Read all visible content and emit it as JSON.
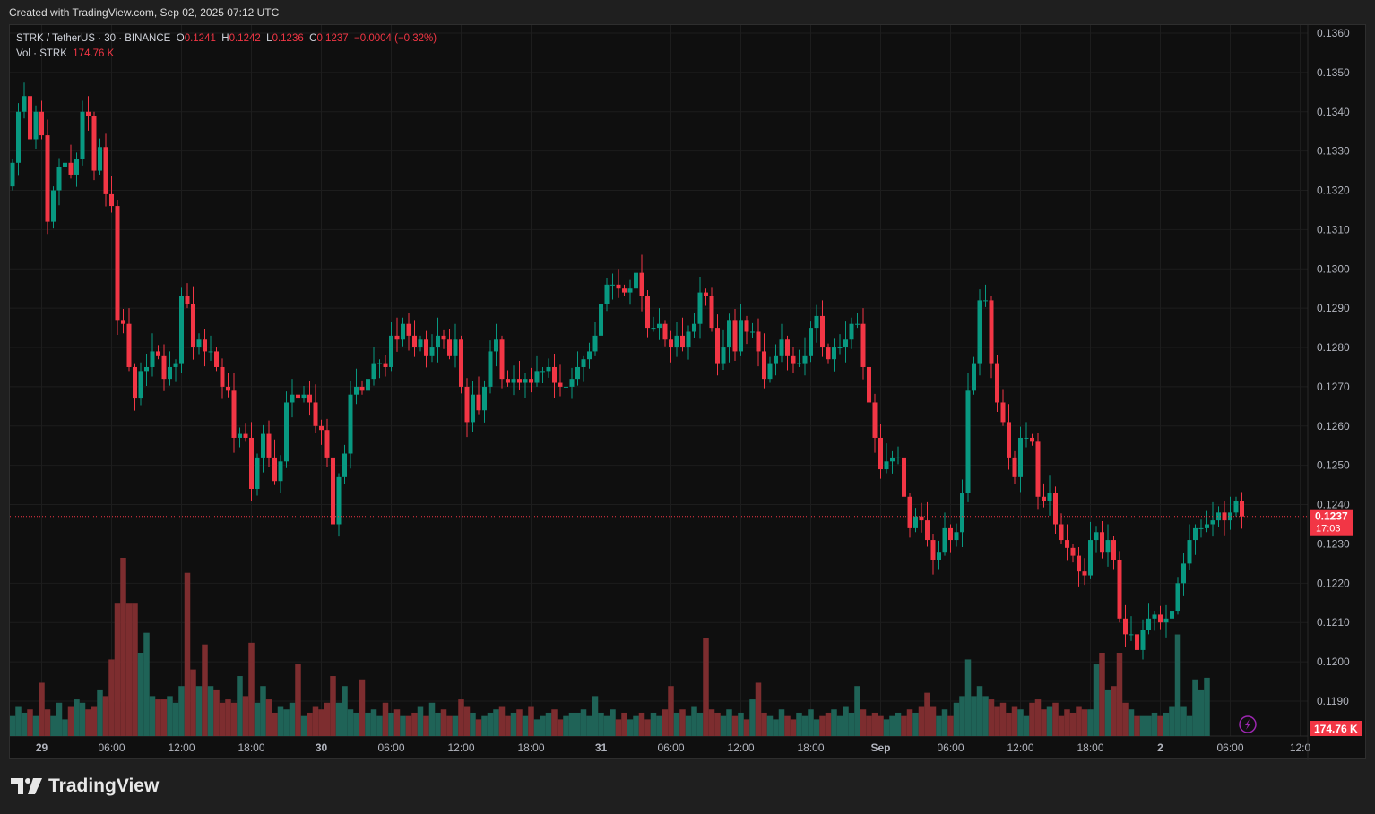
{
  "header": {
    "created": "Created with TradingView.com, Sep 02, 2025 07:12 UTC"
  },
  "legend": {
    "symbol": "STRK / TetherUS · 30 · BINANCE",
    "o_label": "O",
    "o": "0.1241",
    "h_label": "H",
    "h": "0.1242",
    "l_label": "L",
    "l": "0.1236",
    "c_label": "C",
    "c": "0.1237",
    "change": "−0.0004 (−0.32%)",
    "vol_label": "Vol · STRK",
    "vol": "174.76 K"
  },
  "price_tag": {
    "price": "0.1237",
    "countdown": "17:03"
  },
  "vol_tag": "174.76 K",
  "footer": {
    "logo": "TradingView"
  },
  "colors": {
    "up": "#089981",
    "down": "#f23645",
    "vol_up": "#1f6357",
    "vol_down": "#7d2d2f",
    "bg": "#0f0f0f",
    "grid": "#1d1d1d"
  },
  "chart_data": {
    "type": "candlestick",
    "title": "STRK / TetherUS · 30 · BINANCE",
    "ylim": [
      0.1185,
      0.1362
    ],
    "y_ticks": [
      "0.1360",
      "0.1350",
      "0.1340",
      "0.1330",
      "0.1320",
      "0.1310",
      "0.1300",
      "0.1290",
      "0.1280",
      "0.1270",
      "0.1260",
      "0.1250",
      "0.1240",
      "0.1230",
      "0.1220",
      "0.1210",
      "0.1200",
      "0.1190"
    ],
    "x_ticks": [
      "29",
      "06:00",
      "12:00",
      "18:00",
      "30",
      "06:00",
      "12:00",
      "18:00",
      "31",
      "06:00",
      "12:00",
      "18:00",
      "Sep",
      "06:00",
      "12:00",
      "18:00",
      "2",
      "06:00",
      "12:0"
    ],
    "x_tick_every": 12,
    "x_tick_start_index": 5,
    "first_open": 0.1321,
    "last_price": 0.1237,
    "closes": [
      0.1327,
      0.134,
      0.1344,
      0.1333,
      0.134,
      0.1334,
      0.1312,
      0.132,
      0.1326,
      0.1327,
      0.1324,
      0.1328,
      0.134,
      0.1339,
      0.1325,
      0.1331,
      0.1319,
      0.1316,
      0.1287,
      0.1286,
      0.1275,
      0.1267,
      0.1274,
      0.1275,
      0.1279,
      0.1278,
      0.1272,
      0.1275,
      0.1276,
      0.1293,
      0.1291,
      0.128,
      0.1282,
      0.1279,
      0.1279,
      0.1275,
      0.127,
      0.1269,
      0.1257,
      0.1258,
      0.1257,
      0.1244,
      0.1252,
      0.1258,
      0.1252,
      0.1246,
      0.1251,
      0.1266,
      0.1268,
      0.1267,
      0.1268,
      0.1266,
      0.126,
      0.1259,
      0.1252,
      0.1235,
      0.1247,
      0.1253,
      0.1268,
      0.127,
      0.1269,
      0.1272,
      0.1276,
      0.1276,
      0.1275,
      0.1283,
      0.1282,
      0.1286,
      0.1283,
      0.128,
      0.1282,
      0.1278,
      0.128,
      0.1283,
      0.1282,
      0.1278,
      0.1282,
      0.127,
      0.1261,
      0.1268,
      0.1264,
      0.127,
      0.1279,
      0.1282,
      0.1272,
      0.1271,
      0.1272,
      0.1271,
      0.1272,
      0.1271,
      0.1274,
      0.1274,
      0.1275,
      0.1271,
      0.127,
      0.127,
      0.1272,
      0.1275,
      0.1277,
      0.1279,
      0.1283,
      0.1291,
      0.1296,
      0.1296,
      0.1295,
      0.1294,
      0.1295,
      0.1299,
      0.1293,
      0.1285,
      0.1285,
      0.1286,
      0.1282,
      0.128,
      0.1283,
      0.128,
      0.1284,
      0.1286,
      0.1294,
      0.1293,
      0.1285,
      0.1276,
      0.128,
      0.1287,
      0.1279,
      0.1287,
      0.1284,
      0.1284,
      0.1279,
      0.1272,
      0.1276,
      0.1278,
      0.1282,
      0.1278,
      0.1276,
      0.1276,
      0.1278,
      0.1285,
      0.1288,
      0.128,
      0.1277,
      0.128,
      0.128,
      0.1282,
      0.1286,
      0.1286,
      0.1275,
      0.1266,
      0.1257,
      0.1249,
      0.1251,
      0.1252,
      0.1252,
      0.1242,
      0.1234,
      0.1237,
      0.1236,
      0.1231,
      0.1226,
      0.1228,
      0.1234,
      0.1231,
      0.1233,
      0.1243,
      0.1269,
      0.1276,
      0.1292,
      0.1292,
      0.1276,
      0.1266,
      0.1261,
      0.1252,
      0.1247,
      0.1257,
      0.1257,
      0.1256,
      0.1242,
      0.1241,
      0.1243,
      0.1235,
      0.1231,
      0.1229,
      0.1227,
      0.1223,
      0.1222,
      0.1231,
      0.1233,
      0.1228,
      0.1231,
      0.1226,
      0.1211,
      0.1207,
      0.1207,
      0.1203,
      0.1208,
      0.1211,
      0.1212,
      0.121,
      0.1211,
      0.1213,
      0.122,
      0.1225,
      0.1231,
      0.1234,
      0.1234,
      0.1235,
      0.1236,
      0.1238,
      0.1236,
      0.1238,
      0.1241,
      0.1237
    ],
    "volumes_k": [
      60,
      90,
      70,
      80,
      60,
      160,
      80,
      60,
      100,
      50,
      90,
      110,
      100,
      80,
      90,
      140,
      120,
      230,
      400,
      535,
      400,
      400,
      250,
      310,
      120,
      110,
      110,
      120,
      100,
      150,
      490,
      200,
      150,
      275,
      150,
      140,
      100,
      110,
      100,
      180,
      120,
      280,
      100,
      150,
      110,
      70,
      90,
      80,
      100,
      215,
      60,
      70,
      90,
      80,
      100,
      180,
      100,
      150,
      80,
      70,
      170,
      70,
      80,
      60,
      100,
      70,
      80,
      60,
      60,
      70,
      90,
      60,
      100,
      70,
      80,
      60,
      60,
      110,
      90,
      70,
      50,
      60,
      70,
      80,
      90,
      60,
      70,
      80,
      60,
      90,
      50,
      60,
      70,
      80,
      50,
      60,
      70,
      70,
      80,
      60,
      120,
      70,
      60,
      80,
      50,
      70,
      50,
      60,
      70,
      50,
      70,
      60,
      80,
      150,
      70,
      80,
      60,
      90,
      70,
      295,
      80,
      70,
      60,
      80,
      60,
      70,
      50,
      110,
      160,
      70,
      60,
      50,
      80,
      60,
      50,
      70,
      60,
      80,
      50,
      60,
      70,
      80,
      60,
      90,
      70,
      150,
      80,
      60,
      70,
      60,
      50,
      60,
      70,
      60,
      80,
      70,
      90,
      130,
      90,
      60,
      80,
      60,
      100,
      120,
      230,
      120,
      150,
      120,
      110,
      90,
      100,
      70,
      90,
      80,
      60,
      100,
      110,
      80,
      90,
      100,
      60,
      80,
      70,
      90,
      80,
      80,
      215,
      250,
      140,
      150,
      250,
      100,
      80,
      60,
      60,
      60,
      70,
      60,
      70,
      90,
      305,
      90,
      60,
      170,
      140,
      175
    ]
  }
}
